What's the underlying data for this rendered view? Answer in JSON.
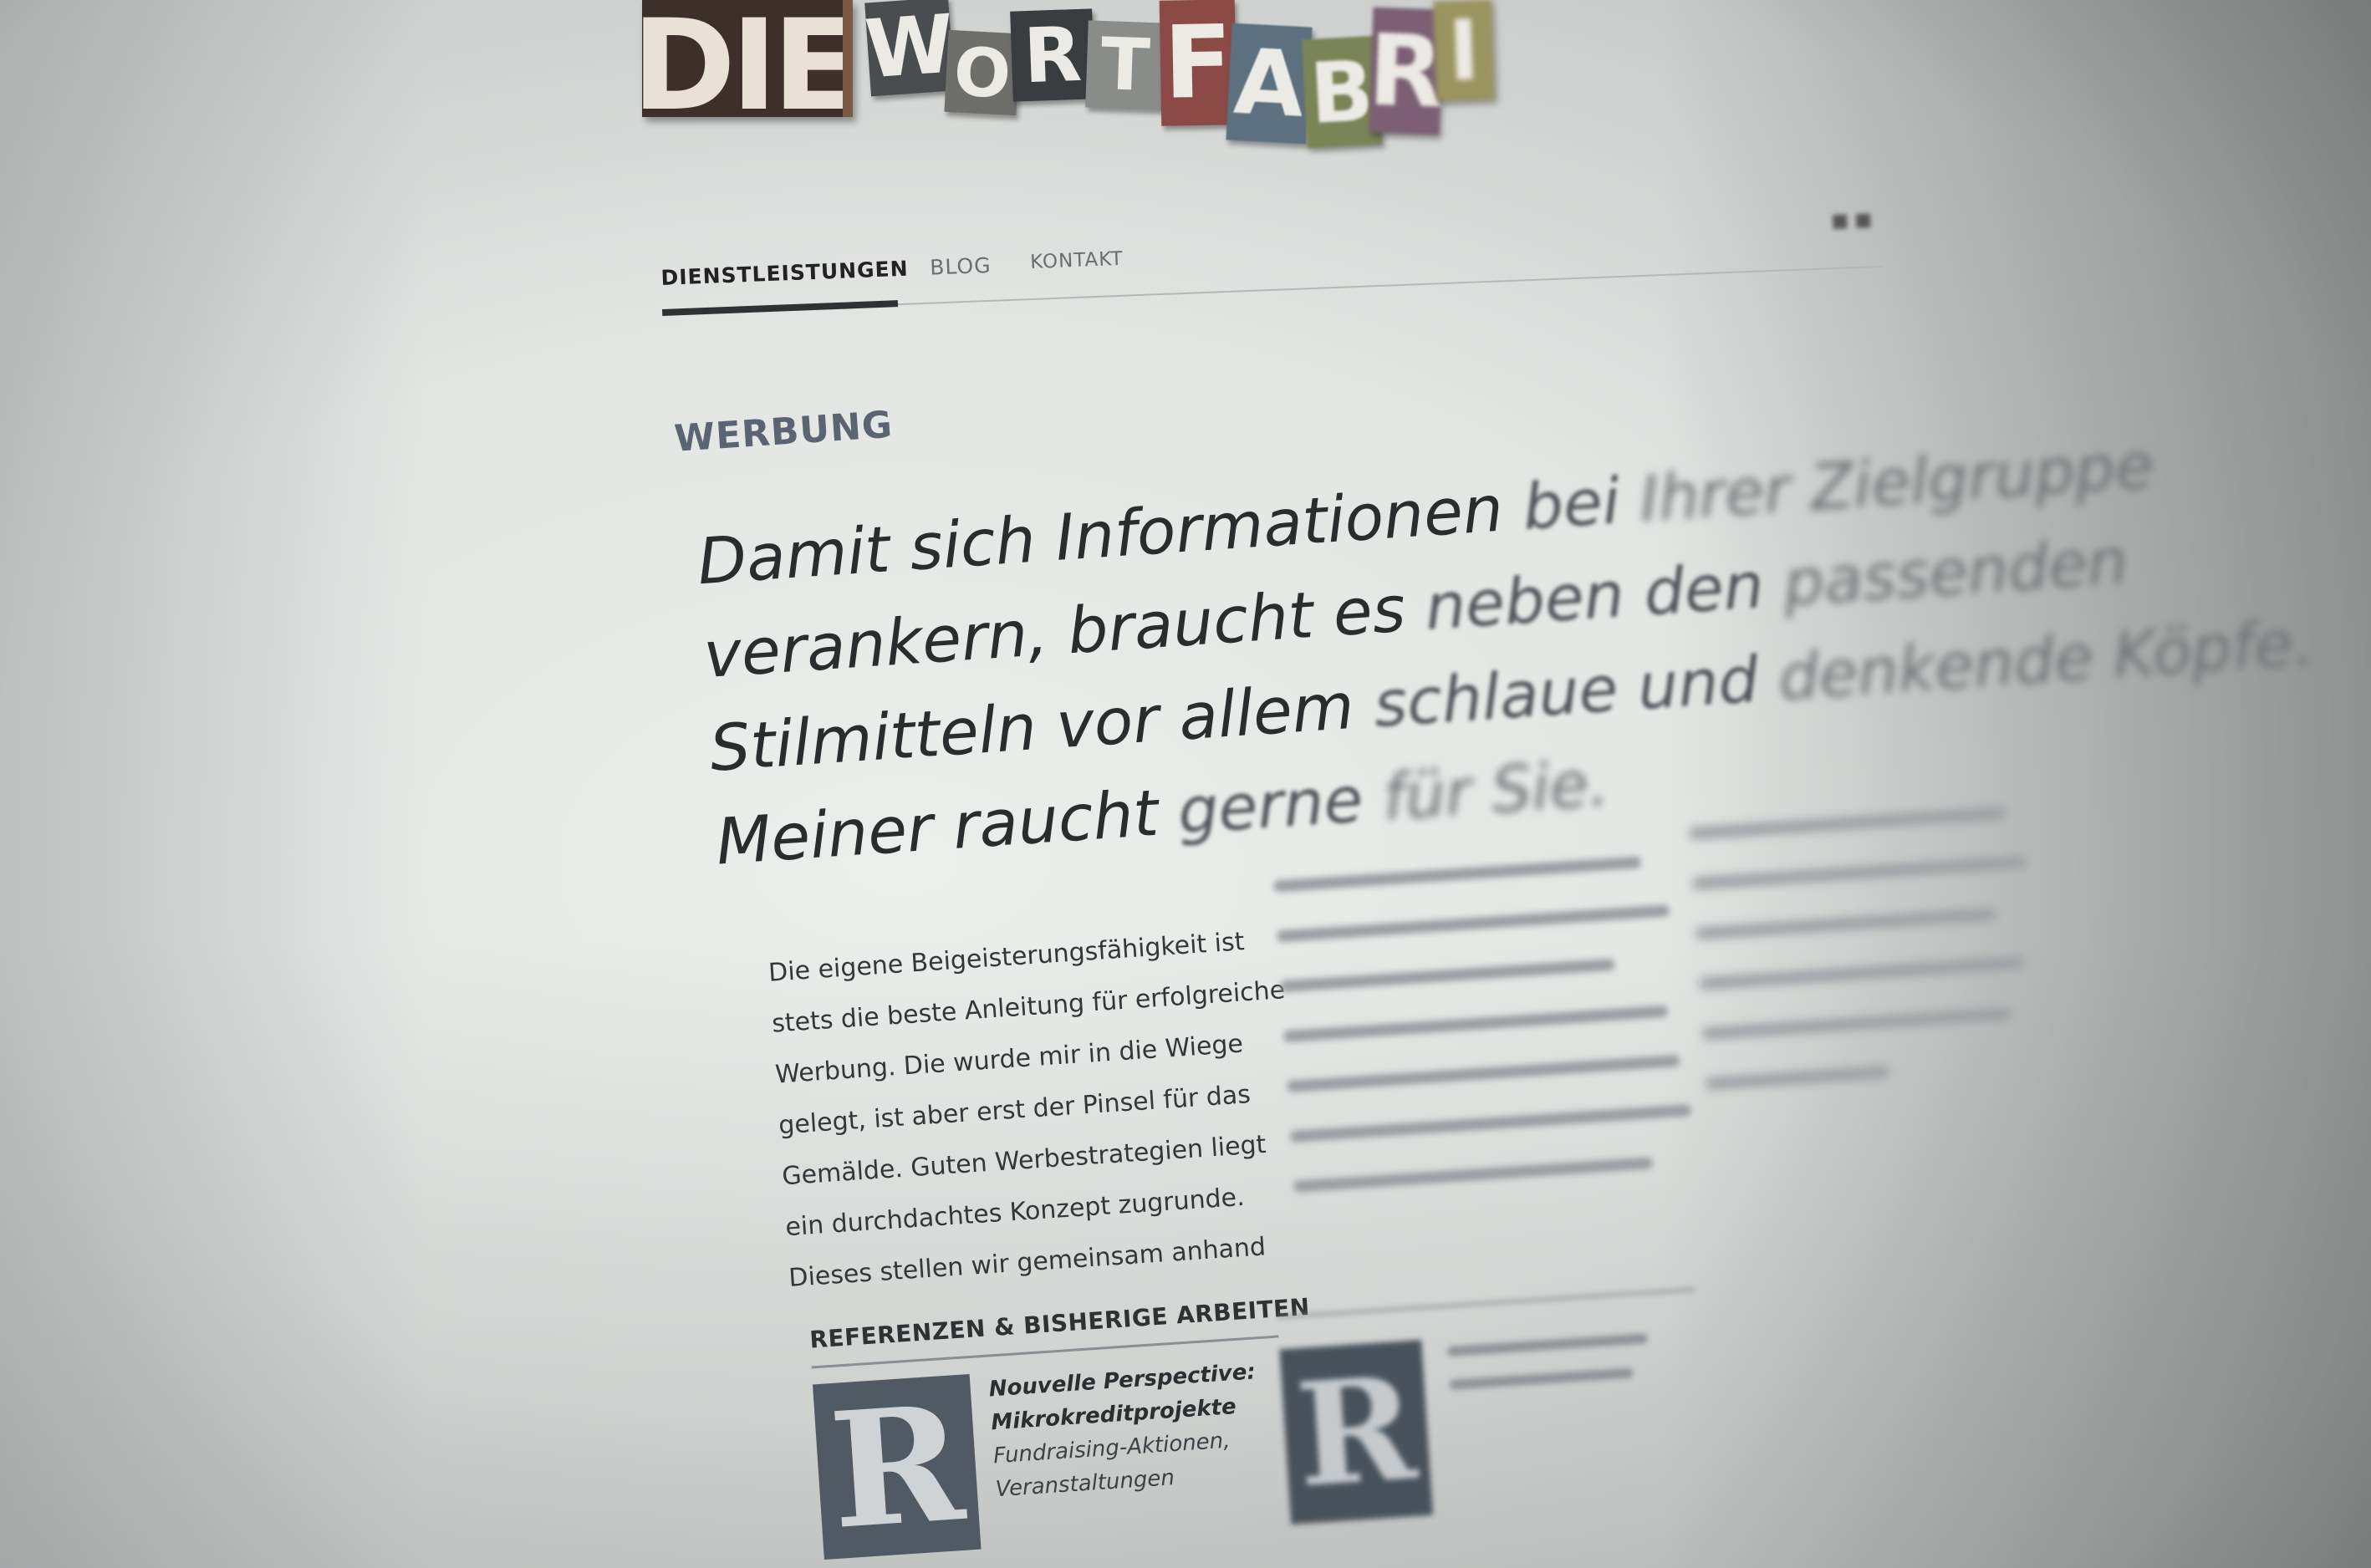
{
  "logo": {
    "text_part1": "DIE",
    "letters": [
      {
        "ch": "W",
        "bg": "#4a4d50"
      },
      {
        "ch": "O",
        "bg": "#6e6e6b"
      },
      {
        "ch": "R",
        "bg": "#3a3d40"
      },
      {
        "ch": "T",
        "bg": "#8a8c89"
      },
      {
        "ch": "F",
        "bg": "#8b4a46"
      },
      {
        "ch": "A",
        "bg": "#5d7080"
      },
      {
        "ch": "B",
        "bg": "#7a8457"
      },
      {
        "ch": "R",
        "bg": "#7c5f74"
      },
      {
        "ch": "I",
        "bg": "#9a9460"
      }
    ]
  },
  "nav": {
    "items": [
      {
        "label": "DIENSTLEISTUNGEN",
        "active": true
      },
      {
        "label": "BLOG",
        "active": false
      },
      {
        "label": "KONTAKT",
        "active": false
      }
    ]
  },
  "section": {
    "label": "WERBUNG"
  },
  "headline": {
    "lines": [
      [
        "Damit sich Informationen ",
        "bei ",
        "Ihrer Zielgruppe"
      ],
      [
        "verankern, braucht es ",
        "neben den ",
        "passenden"
      ],
      [
        "Stilmitteln vor allem ",
        "schlaue und ",
        "denkende Köpfe."
      ],
      [
        "Meiner raucht ",
        "gerne ",
        "für Sie."
      ]
    ]
  },
  "body_col1": {
    "lines": [
      "Die eigene Beigeisterungsfähigkeit ist",
      "stets die beste Anleitung für erfolgreiche",
      "Werbung. Die wurde mir in die Wiege",
      "gelegt, ist aber erst der Pinsel für das",
      "Gemälde. Guten Werbestrategien liegt",
      "ein durchdachtes Konzept zugrunde.",
      "Dieses stellen wir gemeinsam anhand"
    ]
  },
  "references": {
    "title": "REFERENZEN & BISHERIGE ARBEITEN",
    "items": [
      {
        "thumb_letter": "R",
        "title_line1": "Nouvelle Perspective:",
        "title_line2": "Mikrokreditprojekte",
        "sub_line1": "Fundraising-Aktionen,",
        "sub_line2": "Veranstaltungen"
      },
      {
        "thumb_letter": "R"
      }
    ]
  }
}
